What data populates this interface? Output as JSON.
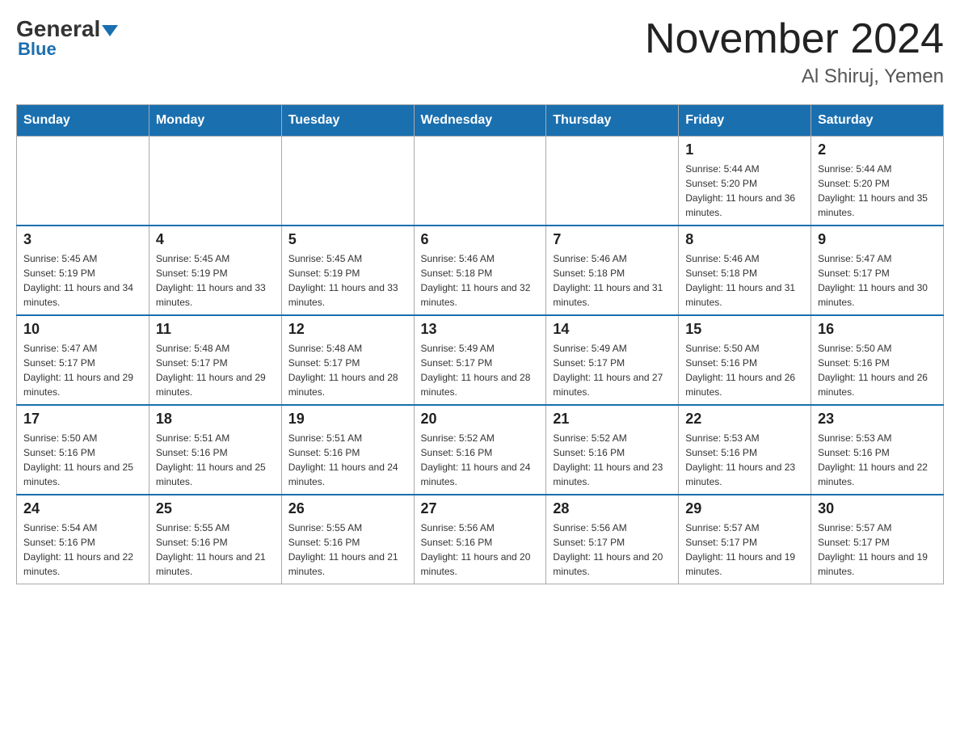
{
  "header": {
    "logo_general": "General",
    "logo_blue": "Blue",
    "title": "November 2024",
    "subtitle": "Al Shiruj, Yemen"
  },
  "days_of_week": [
    "Sunday",
    "Monday",
    "Tuesday",
    "Wednesday",
    "Thursday",
    "Friday",
    "Saturday"
  ],
  "weeks": [
    {
      "days": [
        {
          "number": "",
          "info": ""
        },
        {
          "number": "",
          "info": ""
        },
        {
          "number": "",
          "info": ""
        },
        {
          "number": "",
          "info": ""
        },
        {
          "number": "",
          "info": ""
        },
        {
          "number": "1",
          "info": "Sunrise: 5:44 AM\nSunset: 5:20 PM\nDaylight: 11 hours and 36 minutes."
        },
        {
          "number": "2",
          "info": "Sunrise: 5:44 AM\nSunset: 5:20 PM\nDaylight: 11 hours and 35 minutes."
        }
      ]
    },
    {
      "days": [
        {
          "number": "3",
          "info": "Sunrise: 5:45 AM\nSunset: 5:19 PM\nDaylight: 11 hours and 34 minutes."
        },
        {
          "number": "4",
          "info": "Sunrise: 5:45 AM\nSunset: 5:19 PM\nDaylight: 11 hours and 33 minutes."
        },
        {
          "number": "5",
          "info": "Sunrise: 5:45 AM\nSunset: 5:19 PM\nDaylight: 11 hours and 33 minutes."
        },
        {
          "number": "6",
          "info": "Sunrise: 5:46 AM\nSunset: 5:18 PM\nDaylight: 11 hours and 32 minutes."
        },
        {
          "number": "7",
          "info": "Sunrise: 5:46 AM\nSunset: 5:18 PM\nDaylight: 11 hours and 31 minutes."
        },
        {
          "number": "8",
          "info": "Sunrise: 5:46 AM\nSunset: 5:18 PM\nDaylight: 11 hours and 31 minutes."
        },
        {
          "number": "9",
          "info": "Sunrise: 5:47 AM\nSunset: 5:17 PM\nDaylight: 11 hours and 30 minutes."
        }
      ]
    },
    {
      "days": [
        {
          "number": "10",
          "info": "Sunrise: 5:47 AM\nSunset: 5:17 PM\nDaylight: 11 hours and 29 minutes."
        },
        {
          "number": "11",
          "info": "Sunrise: 5:48 AM\nSunset: 5:17 PM\nDaylight: 11 hours and 29 minutes."
        },
        {
          "number": "12",
          "info": "Sunrise: 5:48 AM\nSunset: 5:17 PM\nDaylight: 11 hours and 28 minutes."
        },
        {
          "number": "13",
          "info": "Sunrise: 5:49 AM\nSunset: 5:17 PM\nDaylight: 11 hours and 28 minutes."
        },
        {
          "number": "14",
          "info": "Sunrise: 5:49 AM\nSunset: 5:17 PM\nDaylight: 11 hours and 27 minutes."
        },
        {
          "number": "15",
          "info": "Sunrise: 5:50 AM\nSunset: 5:16 PM\nDaylight: 11 hours and 26 minutes."
        },
        {
          "number": "16",
          "info": "Sunrise: 5:50 AM\nSunset: 5:16 PM\nDaylight: 11 hours and 26 minutes."
        }
      ]
    },
    {
      "days": [
        {
          "number": "17",
          "info": "Sunrise: 5:50 AM\nSunset: 5:16 PM\nDaylight: 11 hours and 25 minutes."
        },
        {
          "number": "18",
          "info": "Sunrise: 5:51 AM\nSunset: 5:16 PM\nDaylight: 11 hours and 25 minutes."
        },
        {
          "number": "19",
          "info": "Sunrise: 5:51 AM\nSunset: 5:16 PM\nDaylight: 11 hours and 24 minutes."
        },
        {
          "number": "20",
          "info": "Sunrise: 5:52 AM\nSunset: 5:16 PM\nDaylight: 11 hours and 24 minutes."
        },
        {
          "number": "21",
          "info": "Sunrise: 5:52 AM\nSunset: 5:16 PM\nDaylight: 11 hours and 23 minutes."
        },
        {
          "number": "22",
          "info": "Sunrise: 5:53 AM\nSunset: 5:16 PM\nDaylight: 11 hours and 23 minutes."
        },
        {
          "number": "23",
          "info": "Sunrise: 5:53 AM\nSunset: 5:16 PM\nDaylight: 11 hours and 22 minutes."
        }
      ]
    },
    {
      "days": [
        {
          "number": "24",
          "info": "Sunrise: 5:54 AM\nSunset: 5:16 PM\nDaylight: 11 hours and 22 minutes."
        },
        {
          "number": "25",
          "info": "Sunrise: 5:55 AM\nSunset: 5:16 PM\nDaylight: 11 hours and 21 minutes."
        },
        {
          "number": "26",
          "info": "Sunrise: 5:55 AM\nSunset: 5:16 PM\nDaylight: 11 hours and 21 minutes."
        },
        {
          "number": "27",
          "info": "Sunrise: 5:56 AM\nSunset: 5:16 PM\nDaylight: 11 hours and 20 minutes."
        },
        {
          "number": "28",
          "info": "Sunrise: 5:56 AM\nSunset: 5:17 PM\nDaylight: 11 hours and 20 minutes."
        },
        {
          "number": "29",
          "info": "Sunrise: 5:57 AM\nSunset: 5:17 PM\nDaylight: 11 hours and 19 minutes."
        },
        {
          "number": "30",
          "info": "Sunrise: 5:57 AM\nSunset: 5:17 PM\nDaylight: 11 hours and 19 minutes."
        }
      ]
    }
  ]
}
